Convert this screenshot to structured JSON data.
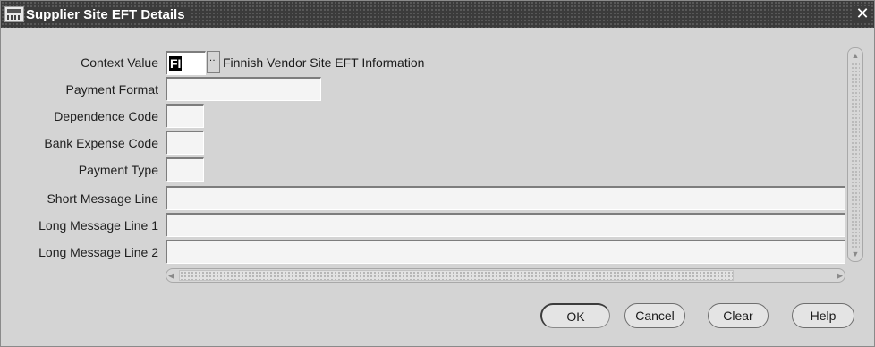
{
  "window": {
    "title": "Supplier Site EFT Details",
    "close_symbol": "✕",
    "icon": "oracle-forms-icon"
  },
  "form": {
    "context_value": {
      "label": "Context Value",
      "value": "FI",
      "lov_symbol": "…",
      "description": "Finnish Vendor Site EFT Information"
    },
    "payment_format": {
      "label": "Payment Format",
      "value": ""
    },
    "dependence_code": {
      "label": "Dependence Code",
      "value": ""
    },
    "bank_expense_code": {
      "label": "Bank Expense Code",
      "value": ""
    },
    "payment_type": {
      "label": "Payment Type",
      "value": ""
    },
    "short_message_line": {
      "label": "Short Message Line",
      "value": ""
    },
    "long_message_line_1": {
      "label": "Long Message Line 1",
      "value": ""
    },
    "long_message_line_2": {
      "label": "Long Message Line 2",
      "value": ""
    }
  },
  "buttons": {
    "ok": "OK",
    "cancel": "Cancel",
    "clear": "Clear",
    "help": "Help"
  },
  "colors": {
    "titlebar": "#3b3b3b",
    "background": "#d4d4d4",
    "field": "#f4f4f4"
  }
}
